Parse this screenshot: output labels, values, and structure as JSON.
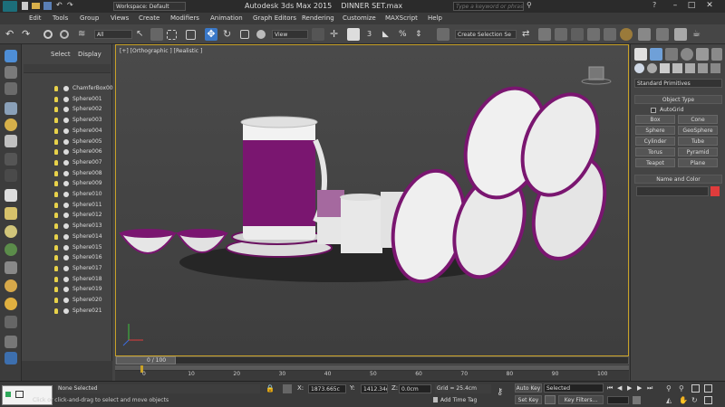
{
  "titlebar": {
    "workspace_label": "Workspace: Default",
    "app_title": "Autodesk 3ds Max  2015",
    "file_name": "DINNER SET.max",
    "search_placeholder": "Type a keyword or phrase"
  },
  "menubar": {
    "items": [
      "Edit",
      "Tools",
      "Group",
      "Views",
      "Create",
      "Modifiers",
      "Animation",
      "Graph Editors",
      "Rendering",
      "Customize",
      "MAXScript",
      "Help"
    ]
  },
  "toolbar": {
    "selection_filter": "All",
    "ref_coord": "View",
    "named_selection": "Create Selection Se"
  },
  "explorer": {
    "tab_select": "Select",
    "tab_display": "Display",
    "items": [
      "ChamferBox00",
      "Sphere001",
      "Sphere002",
      "Sphere003",
      "Sphere004",
      "Sphere005",
      "Sphere006",
      "Sphere007",
      "Sphere008",
      "Sphere009",
      "Sphere010",
      "Sphere011",
      "Sphere012",
      "Sphere013",
      "Sphere014",
      "Sphere015",
      "Sphere016",
      "Sphere017",
      "Sphere018",
      "Sphere019",
      "Sphere020",
      "Sphere021"
    ]
  },
  "viewport": {
    "label": "[+] [Orthographic ] [Realistic ]"
  },
  "cmdpanel": {
    "category": "Standard Primitives",
    "object_type_head": "Object Type",
    "autogrid": "AutoGrid",
    "primitives": [
      "Box",
      "Cone",
      "Sphere",
      "GeoSphere",
      "Cylinder",
      "Tube",
      "Torus",
      "Pyramid",
      "Teapot",
      "Plane"
    ],
    "name_color_head": "Name and Color",
    "swatch_color": "#e03c3c"
  },
  "timeline": {
    "frame_readout": "0 / 100",
    "ticks": [
      "0",
      "10",
      "20",
      "30",
      "40",
      "50",
      "60",
      "70",
      "80",
      "90",
      "100"
    ]
  },
  "statusbar": {
    "selection_status": "None Selected",
    "prompt": "Click or click-and-drag to select and move objects",
    "x_label": "X:",
    "x_value": "1873.665c",
    "y_label": "Y:",
    "y_value": "1412.34cm",
    "z_label": "Z:",
    "z_value": "0.0cm",
    "grid": "Grid = 25.4cm",
    "add_time_tag": "Add Time Tag",
    "auto_key": "Auto Key",
    "key_mode": "Selected",
    "set_key": "Set Key",
    "key_filters": "Key Filters..."
  },
  "colors": {
    "accent_purple": "#7a1670",
    "viewport_border": "#c9a227"
  }
}
